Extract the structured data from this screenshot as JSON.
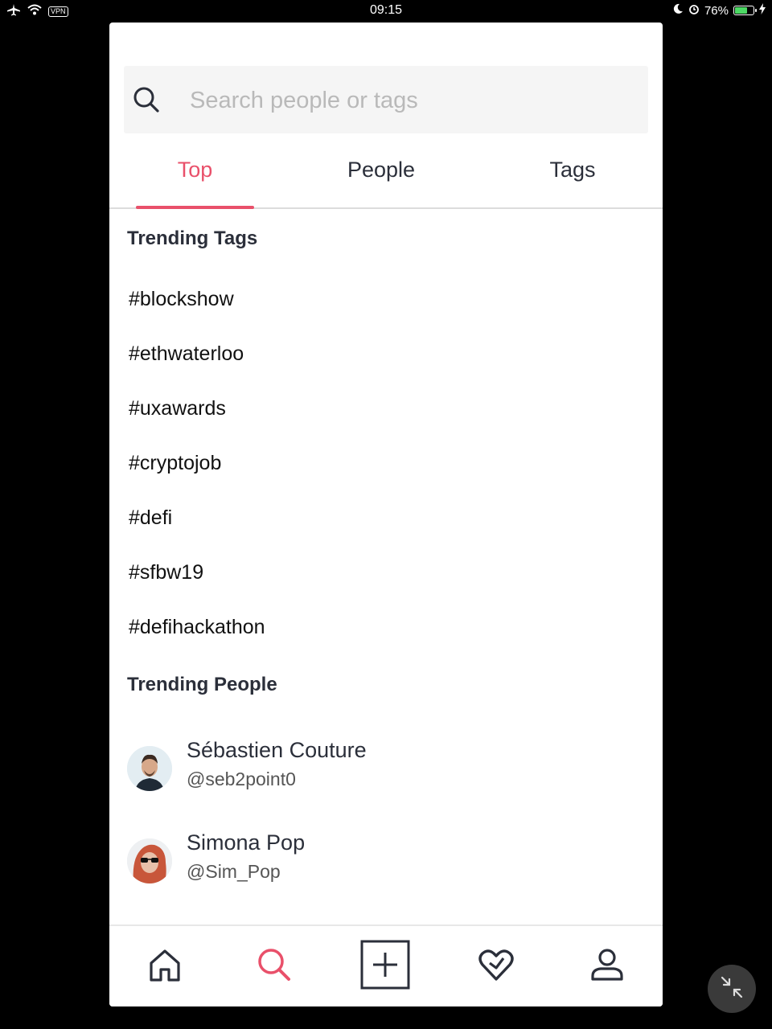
{
  "status_bar": {
    "vpn_label": "VPN",
    "time": "09:15",
    "battery_percent": "76%",
    "battery_level": 0.76
  },
  "search": {
    "placeholder": "Search people or tags",
    "value": ""
  },
  "tabs": [
    {
      "label": "Top",
      "active": true
    },
    {
      "label": "People",
      "active": false
    },
    {
      "label": "Tags",
      "active": false
    }
  ],
  "trending_tags": {
    "title": "Trending Tags",
    "items": [
      "#blockshow",
      "#ethwaterloo",
      "#uxawards",
      "#cryptojob",
      "#defi",
      "#sfbw19",
      "#defihackathon"
    ]
  },
  "trending_people": {
    "title": "Trending People",
    "items": [
      {
        "name": "Sébastien Couture",
        "handle": "@seb2point0"
      },
      {
        "name": "Simona Pop",
        "handle": "@Sim_Pop"
      }
    ]
  },
  "bottom_nav": [
    "home-icon",
    "search-icon",
    "add-post-icon",
    "heart-icon",
    "profile-icon"
  ],
  "colors": {
    "accent": "#e9506a",
    "text": "#2b2f3a",
    "battery": "#4cd964"
  }
}
